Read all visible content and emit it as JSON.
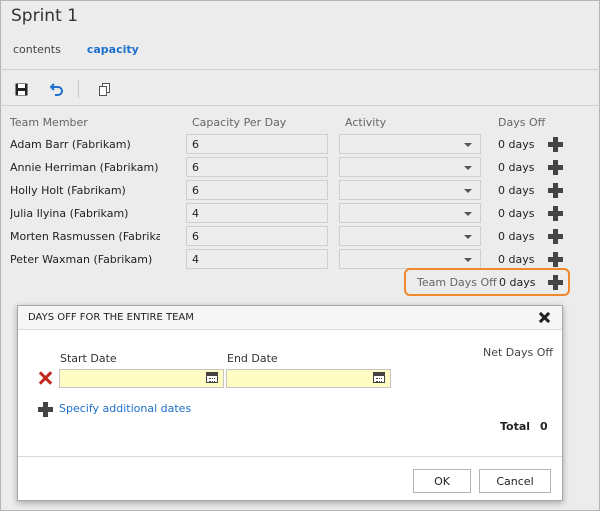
{
  "title": "Sprint 1",
  "tabs": [
    {
      "label": "contents",
      "active": false
    },
    {
      "label": "capacity",
      "active": true
    }
  ],
  "toolbar": {
    "icons": [
      "save-icon",
      "undo-icon",
      "copy-icon"
    ]
  },
  "columns": {
    "member": "Team Member",
    "capacity": "Capacity Per Day",
    "activity": "Activity",
    "days_off": "Days Off"
  },
  "members": [
    {
      "name": "Adam Barr (Fabrikam)",
      "capacity": "6",
      "activity": "",
      "days_off": "0 days"
    },
    {
      "name": "Annie Herriman (Fabrikam)",
      "capacity": "6",
      "activity": "",
      "days_off": "0 days"
    },
    {
      "name": "Holly Holt (Fabrikam)",
      "capacity": "6",
      "activity": "",
      "days_off": "0 days"
    },
    {
      "name": "Julia Ilyina (Fabrikam)",
      "capacity": "4",
      "activity": "",
      "days_off": "0 days"
    },
    {
      "name": "Morten Rasmussen (Fabrikam)",
      "capacity": "6",
      "activity": "",
      "days_off": "0 days"
    },
    {
      "name": "Peter Waxman (Fabrikam)",
      "capacity": "4",
      "activity": "",
      "days_off": "0 days"
    }
  ],
  "team_days_off": {
    "label": "Team Days Off",
    "value": "0 days",
    "highlight_color": "#f0882c"
  },
  "dialog": {
    "title": "DAYS OFF FOR THE ENTIRE TEAM",
    "start_label": "Start Date",
    "end_label": "End Date",
    "start_value": "",
    "end_value": "",
    "net_label": "Net Days Off",
    "link": "Specify additional dates",
    "total_label": "Total",
    "total_value": "0",
    "ok": "OK",
    "cancel": "Cancel"
  },
  "colors": {
    "accent": "#1e6fcc",
    "date_field": "#fffdc4",
    "delete": "#c0291b"
  }
}
